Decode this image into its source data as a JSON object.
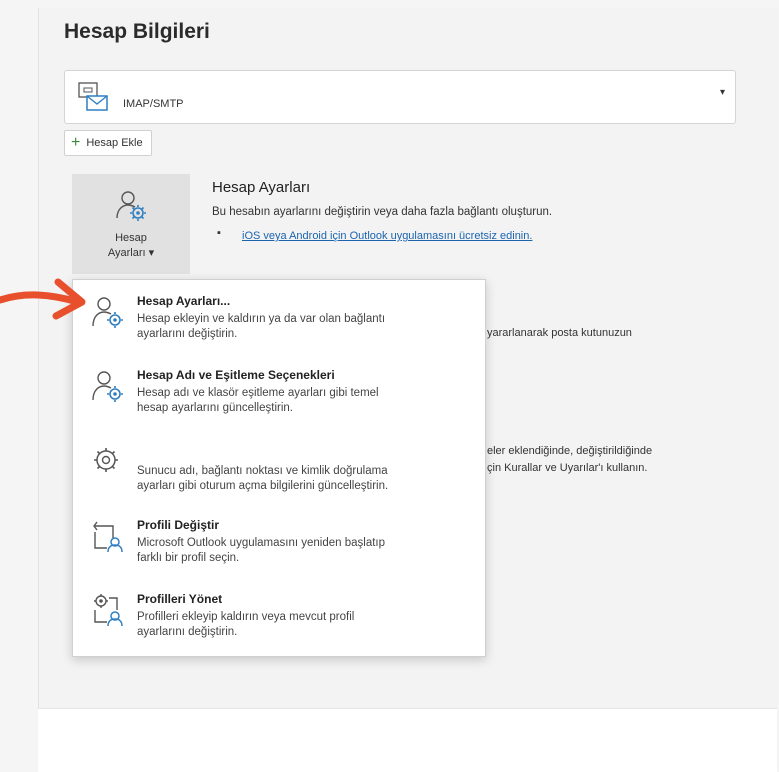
{
  "page": {
    "title": "Hesap Bilgileri"
  },
  "account_select": {
    "label": "IMAP/SMTP",
    "caret": "▾"
  },
  "add_account": {
    "icon_text": "+",
    "label": "Hesap Ekle"
  },
  "settings_tile": {
    "label_line1": "Hesap",
    "label_line2": "Ayarları ▾"
  },
  "account_settings_section": {
    "title": "Hesap Ayarları",
    "description": "Bu hesabın ayarlarını değiştirin veya daha fazla bağlantı oluşturun.",
    "bullet": "▪",
    "link_text": "iOS veya Android için Outlook uygulamasını ücretsiz edinin."
  },
  "background_text": {
    "mailbox_fragment": "yararlanarak posta kutunuzun",
    "rules_fragment_1": "eler eklendiğinde, değiştirildiğinde",
    "rules_fragment_2": "çin Kurallar ve Uyarılar'ı kullanın."
  },
  "dropdown_menu": {
    "items": [
      {
        "icon": "account-settings-icon",
        "title": "Hesap Ayarları...",
        "desc_line1": "Hesap ekleyin ve kaldırın ya da var olan bağlantı",
        "desc_line2": "ayarlarını değiştirin."
      },
      {
        "icon": "account-name-sync-icon",
        "title": "Hesap Adı ve Eşitleme Seçenekleri",
        "desc_line1": "Hesap adı ve klasör eşitleme ayarları gibi temel",
        "desc_line2": "hesap ayarlarını güncelleştirin."
      },
      {
        "icon": "gear-icon",
        "title": "",
        "desc_line1": "Sunucu adı, bağlantı noktası ve kimlik doğrulama",
        "desc_line2": "ayarları gibi oturum açma bilgilerini güncelleştirin."
      },
      {
        "icon": "change-profile-icon",
        "title": "Profili Değiştir",
        "desc_line1": "Microsoft Outlook uygulamasını yeniden başlatıp",
        "desc_line2": "farklı bir profil seçin."
      },
      {
        "icon": "manage-profiles-icon",
        "title": "Profilleri Yönet",
        "desc_line1": "Profilleri ekleyip kaldırın veya mevcut profil",
        "desc_line2": "ayarlarını değiştirin."
      }
    ]
  },
  "colors": {
    "arrow": "#e8502d",
    "link": "#1a64b0",
    "icon_blue": "#2f7fc2"
  }
}
